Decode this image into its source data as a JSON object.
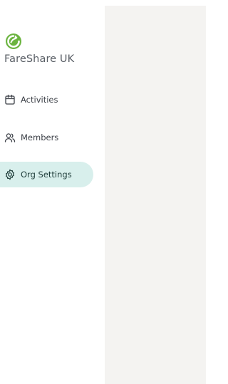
{
  "org": {
    "name": "FareShare UK",
    "logo_icon": "fareshare-logo-icon",
    "logo_color": "#6bb43f"
  },
  "nav": {
    "items": [
      {
        "label": "Activities",
        "icon": "calendar-icon",
        "active": false
      },
      {
        "label": "Members",
        "icon": "users-icon",
        "active": false
      },
      {
        "label": "Org Settings",
        "icon": "gear-icon",
        "active": true
      }
    ]
  },
  "colors": {
    "active_bg": "#d8efec",
    "content_bg": "#f4f3f1",
    "text": "#3d4148",
    "muted_text": "#5a5f66"
  }
}
